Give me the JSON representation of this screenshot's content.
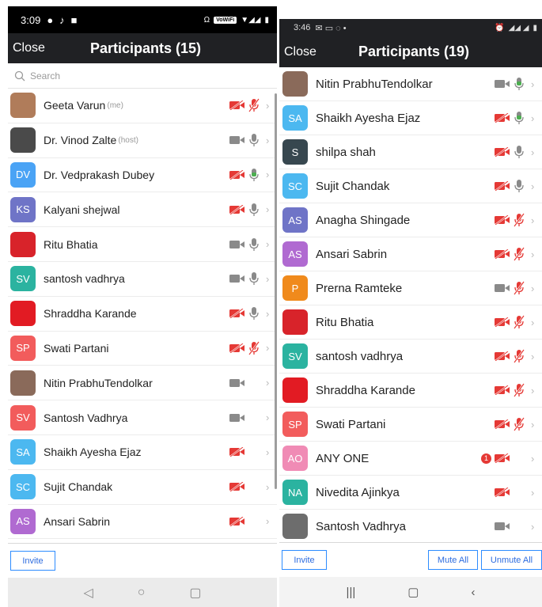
{
  "colors": {
    "accent": "#2d8cff",
    "muted_red": "#e53935",
    "mic_green": "#4caf50",
    "header_bg": "#202124"
  },
  "left": {
    "status": {
      "time": "3:09",
      "wifi_label": "VoWiFi"
    },
    "header": {
      "close_label": "Close",
      "title": "Participants (15)"
    },
    "search": {
      "placeholder": "Search"
    },
    "participants": [
      {
        "name": "Geeta Varun",
        "tag": "(me)",
        "initials": "",
        "avatar_color": "#b07c5a",
        "video": "off",
        "audio": "muted"
      },
      {
        "name": "Dr. Vinod Zalte",
        "tag": "(host)",
        "initials": "",
        "avatar_color": "#4a4a4a",
        "video": "on",
        "audio": "on"
      },
      {
        "name": "Dr. Vedprakash Dubey",
        "tag": "",
        "initials": "DV",
        "avatar_color": "#4aa3f5",
        "video": "off",
        "audio": "speaking"
      },
      {
        "name": "Kalyani shejwal",
        "tag": "",
        "initials": "KS",
        "avatar_color": "#6f74c7",
        "video": "off",
        "audio": "on"
      },
      {
        "name": "Ritu Bhatia",
        "tag": "",
        "initials": "",
        "avatar_color": "#d8232a",
        "video": "on",
        "audio": "on"
      },
      {
        "name": "santosh vadhrya",
        "tag": "",
        "initials": "SV",
        "avatar_color": "#2bb3a0",
        "video": "on",
        "audio": "on"
      },
      {
        "name": "Shraddha Karande",
        "tag": "",
        "initials": "",
        "avatar_color": "#e21b23",
        "video": "off",
        "audio": "on"
      },
      {
        "name": "Swati Partani",
        "tag": "",
        "initials": "SP",
        "avatar_color": "#f25c5c",
        "video": "off",
        "audio": "muted"
      },
      {
        "name": "Nitin PrabhuTendolkar",
        "tag": "",
        "initials": "",
        "avatar_color": "#8a6a5a",
        "video": "on",
        "audio": "none"
      },
      {
        "name": "Santosh Vadhrya",
        "tag": "",
        "initials": "SV",
        "avatar_color": "#f25c5c",
        "video": "on",
        "audio": "none"
      },
      {
        "name": "Shaikh Ayesha Ejaz",
        "tag": "",
        "initials": "SA",
        "avatar_color": "#4cb8f0",
        "video": "off",
        "audio": "none"
      },
      {
        "name": "Sujit Chandak",
        "tag": "",
        "initials": "SC",
        "avatar_color": "#4cb8f0",
        "video": "off",
        "audio": "none"
      },
      {
        "name": "Ansari Sabrin",
        "tag": "",
        "initials": "AS",
        "avatar_color": "#b06ad1",
        "video": "off",
        "audio": "none"
      }
    ],
    "bottom": {
      "invite_label": "Invite"
    }
  },
  "right": {
    "status": {
      "time": "3:46"
    },
    "header": {
      "close_label": "Close",
      "title": "Participants (19)"
    },
    "participants": [
      {
        "name": "Nitin PrabhuTendolkar",
        "initials": "",
        "avatar_color": "#8a6a5a",
        "video": "on",
        "audio": "speaking",
        "badge": ""
      },
      {
        "name": "Shaikh Ayesha Ejaz",
        "initials": "SA",
        "avatar_color": "#4cb8f0",
        "video": "off",
        "audio": "speaking",
        "badge": ""
      },
      {
        "name": "shilpa shah",
        "initials": "S",
        "avatar_color": "#37474f",
        "video": "off",
        "audio": "on",
        "badge": ""
      },
      {
        "name": "Sujit Chandak",
        "initials": "SC",
        "avatar_color": "#4cb8f0",
        "video": "off",
        "audio": "on",
        "badge": ""
      },
      {
        "name": "Anagha Shingade",
        "initials": "AS",
        "avatar_color": "#6f74c7",
        "video": "off",
        "audio": "muted",
        "badge": ""
      },
      {
        "name": "Ansari Sabrin",
        "initials": "AS",
        "avatar_color": "#b06ad1",
        "video": "off",
        "audio": "muted",
        "badge": ""
      },
      {
        "name": "Prerna Ramteke",
        "initials": "P",
        "avatar_color": "#f08a1c",
        "video": "on",
        "audio": "muted",
        "badge": ""
      },
      {
        "name": "Ritu Bhatia",
        "initials": "",
        "avatar_color": "#d8232a",
        "video": "off",
        "audio": "muted",
        "badge": ""
      },
      {
        "name": "santosh vadhrya",
        "initials": "SV",
        "avatar_color": "#2bb3a0",
        "video": "off",
        "audio": "muted",
        "badge": ""
      },
      {
        "name": "Shraddha Karande",
        "initials": "",
        "avatar_color": "#e21b23",
        "video": "off",
        "audio": "muted",
        "badge": ""
      },
      {
        "name": "Swati Partani",
        "initials": "SP",
        "avatar_color": "#f25c5c",
        "video": "off",
        "audio": "muted",
        "badge": ""
      },
      {
        "name": "ANY ONE",
        "initials": "AO",
        "avatar_color": "#f08bb5",
        "video": "off",
        "audio": "none",
        "badge": "1"
      },
      {
        "name": "Nivedita Ajinkya",
        "initials": "NA",
        "avatar_color": "#2bb3a0",
        "video": "off",
        "audio": "none",
        "badge": ""
      },
      {
        "name": "Santosh Vadhrya",
        "initials": "",
        "avatar_color": "#6d6d6d",
        "video": "on",
        "audio": "none",
        "badge": ""
      }
    ],
    "bottom": {
      "invite_label": "Invite",
      "mute_all_label": "Mute All",
      "unmute_all_label": "Unmute All"
    }
  }
}
